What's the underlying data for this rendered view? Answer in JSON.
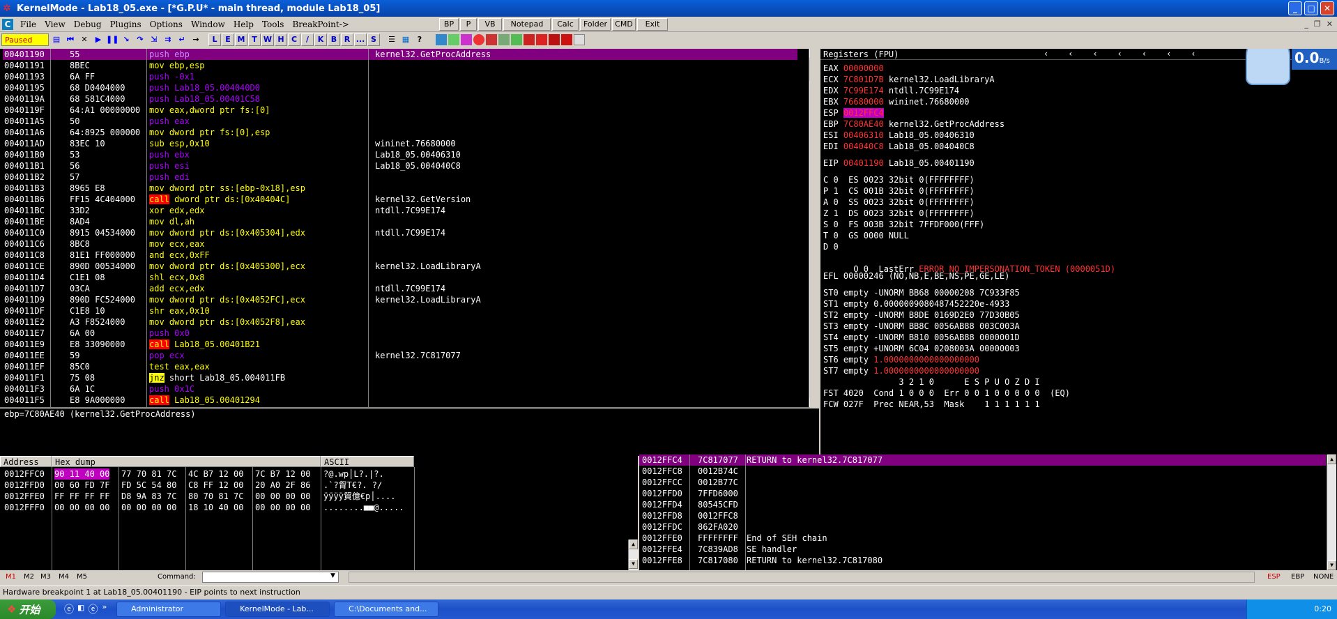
{
  "window": {
    "title": "KernelMode - Lab18_05.exe - [*G.P.U* - main thread, module Lab18_05]"
  },
  "menu": [
    "File",
    "View",
    "Debug",
    "Plugins",
    "Options",
    "Window",
    "Help",
    "Tools",
    "BreakPoint->"
  ],
  "quick_buttons": [
    "BP",
    "P",
    "VB",
    "Notepad",
    "Calc",
    "Folder",
    "CMD",
    "Exit"
  ],
  "toolbar": {
    "status": "Paused",
    "letters": [
      "L",
      "E",
      "M",
      "T",
      "W",
      "H",
      "C",
      "/",
      "K",
      "B",
      "R",
      "...",
      "S"
    ]
  },
  "disasm": [
    {
      "addr": "00401190",
      "hex": "55",
      "asm": "push ebp",
      "kind": "push",
      "cmt": "kernel32.GetProcAddress",
      "sel": true
    },
    {
      "addr": "00401191",
      "hex": "8BEC",
      "asm": "mov ebp,esp",
      "kind": "mov",
      "cmt": ""
    },
    {
      "addr": "00401193",
      "hex": "6A FF",
      "asm": "push -0x1",
      "kind": "push",
      "cmt": ""
    },
    {
      "addr": "00401195",
      "hex": "68 D0404000",
      "asm": "push Lab18_05.004040D0",
      "kind": "push",
      "cmt": ""
    },
    {
      "addr": "0040119A",
      "hex": "68 581C4000",
      "asm": "push Lab18_05.00401C58",
      "kind": "push",
      "cmt": ""
    },
    {
      "addr": "0040119F",
      "hex": "64:A1 00000000",
      "asm": "mov eax,dword ptr fs:[0]",
      "kind": "mov",
      "cmt": ""
    },
    {
      "addr": "004011A5",
      "hex": "50",
      "asm": "push eax",
      "kind": "push",
      "cmt": ""
    },
    {
      "addr": "004011A6",
      "hex": "64:8925 000000",
      "asm": "mov dword ptr fs:[0],esp",
      "kind": "mov",
      "cmt": ""
    },
    {
      "addr": "004011AD",
      "hex": "83EC 10",
      "asm": "sub esp,0x10",
      "kind": "mov",
      "cmt": "wininet.76680000"
    },
    {
      "addr": "004011B0",
      "hex": "53",
      "asm": "push ebx",
      "kind": "push",
      "cmt": "Lab18_05.00406310"
    },
    {
      "addr": "004011B1",
      "hex": "56",
      "asm": "push esi",
      "kind": "push",
      "cmt": "Lab18_05.004040C8"
    },
    {
      "addr": "004011B2",
      "hex": "57",
      "asm": "push edi",
      "kind": "push",
      "cmt": ""
    },
    {
      "addr": "004011B3",
      "hex": "8965 E8",
      "asm": "mov dword ptr ss:[ebp-0x18],esp",
      "kind": "mov",
      "cmt": ""
    },
    {
      "addr": "004011B6",
      "hex": "FF15 4C404000",
      "asm": "call dword ptr ds:[0x40404C]",
      "kind": "call",
      "cmt": "kernel32.GetVersion"
    },
    {
      "addr": "004011BC",
      "hex": "33D2",
      "asm": "xor edx,edx",
      "kind": "mov",
      "cmt": "ntdll.7C99E174"
    },
    {
      "addr": "004011BE",
      "hex": "8AD4",
      "asm": "mov dl,ah",
      "kind": "mov",
      "cmt": ""
    },
    {
      "addr": "004011C0",
      "hex": "8915 04534000",
      "asm": "mov dword ptr ds:[0x405304],edx",
      "kind": "mov",
      "cmt": "ntdll.7C99E174"
    },
    {
      "addr": "004011C6",
      "hex": "8BC8",
      "asm": "mov ecx,eax",
      "kind": "mov",
      "cmt": ""
    },
    {
      "addr": "004011C8",
      "hex": "81E1 FF000000",
      "asm": "and ecx,0xFF",
      "kind": "mov",
      "cmt": ""
    },
    {
      "addr": "004011CE",
      "hex": "890D 00534000",
      "asm": "mov dword ptr ds:[0x405300],ecx",
      "kind": "mov",
      "cmt": "kernel32.LoadLibraryA"
    },
    {
      "addr": "004011D4",
      "hex": "C1E1 08",
      "asm": "shl ecx,0x8",
      "kind": "mov",
      "cmt": ""
    },
    {
      "addr": "004011D7",
      "hex": "03CA",
      "asm": "add ecx,edx",
      "kind": "mov",
      "cmt": "ntdll.7C99E174"
    },
    {
      "addr": "004011D9",
      "hex": "890D FC524000",
      "asm": "mov dword ptr ds:[0x4052FC],ecx",
      "kind": "mov",
      "cmt": "kernel32.LoadLibraryA"
    },
    {
      "addr": "004011DF",
      "hex": "C1E8 10",
      "asm": "shr eax,0x10",
      "kind": "mov",
      "cmt": ""
    },
    {
      "addr": "004011E2",
      "hex": "A3 F8524000",
      "asm": "mov dword ptr ds:[0x4052F8],eax",
      "kind": "mov",
      "cmt": ""
    },
    {
      "addr": "004011E7",
      "hex": "6A 00",
      "asm": "push 0x0",
      "kind": "push",
      "cmt": ""
    },
    {
      "addr": "004011E9",
      "hex": "E8 33090000",
      "asm": "call Lab18_05.00401B21",
      "kind": "call",
      "cmt": ""
    },
    {
      "addr": "004011EE",
      "hex": "59",
      "asm": "pop ecx",
      "kind": "push",
      "cmt": "kernel32.7C817077"
    },
    {
      "addr": "004011EF",
      "hex": "85C0",
      "asm": "test eax,eax",
      "kind": "mov",
      "cmt": ""
    },
    {
      "addr": "004011F1",
      "hex": "75 08",
      "asm": "jnz short Lab18_05.004011FB",
      "kind": "jnz",
      "cmt": ""
    },
    {
      "addr": "004011F3",
      "hex": "6A 1C",
      "asm": "push 0x1C",
      "kind": "push",
      "cmt": ""
    },
    {
      "addr": "004011F5",
      "hex": "E8 9A000000",
      "asm": "call Lab18_05.00401294",
      "kind": "call",
      "cmt": ""
    }
  ],
  "info_line": "ebp=7C80AE40 (kernel32.GetProcAddress)",
  "registers": {
    "header": "Registers (FPU)",
    "gp": [
      {
        "n": "EAX",
        "v": "00000000",
        "c": ""
      },
      {
        "n": "ECX",
        "v": "7C801D7B",
        "c": "kernel32.LoadLibraryA"
      },
      {
        "n": "EDX",
        "v": "7C99E174",
        "c": "ntdll.7C99E174"
      },
      {
        "n": "EBX",
        "v": "76680000",
        "c": "wininet.76680000"
      },
      {
        "n": "ESP",
        "v": "0012FFC4",
        "c": ""
      },
      {
        "n": "EBP",
        "v": "7C80AE40",
        "c": "kernel32.GetProcAddress"
      },
      {
        "n": "ESI",
        "v": "00406310",
        "c": "Lab18_05.00406310"
      },
      {
        "n": "EDI",
        "v": "004040C8",
        "c": "Lab18_05.004040C8"
      }
    ],
    "eip": {
      "n": "EIP",
      "v": "00401190",
      "c": "Lab18_05.00401190"
    },
    "flags": [
      "C 0  ES 0023 32bit 0(FFFFFFFF)",
      "P 1  CS 001B 32bit 0(FFFFFFFF)",
      "A 0  SS 0023 32bit 0(FFFFFFFF)",
      "Z 1  DS 0023 32bit 0(FFFFFFFF)",
      "S 0  FS 003B 32bit 7FFDF000(FFF)",
      "T 0  GS 0000 NULL",
      "D 0"
    ],
    "lasterr": {
      "prefix": "O 0  LastErr ",
      "value": "ERROR_NO_IMPERSONATION_TOKEN (0000051D)"
    },
    "efl": "EFL 00000246 (NO,NB,E,BE,NS,PE,GE,LE)",
    "fpu": [
      {
        "l": "ST0 empty -UNORM BB68 00000208 7C933F85",
        "red": false
      },
      {
        "l": "ST1 empty 0.0000009080487452220e-4933",
        "red": false
      },
      {
        "l": "ST2 empty -UNORM B8DE 0169D2E0 77D30B05",
        "red": false
      },
      {
        "l": "ST3 empty -UNORM BB8C 0056AB88 003C003A",
        "red": false
      },
      {
        "l": "ST4 empty -UNORM B810 0056AB88 0000001D",
        "red": false
      },
      {
        "l": "ST5 empty +UNORM 6C04 0208003A 00000003",
        "red": false
      },
      {
        "l": "ST6 empty 1.0000000000000000000",
        "red": true
      },
      {
        "l": "ST7 empty 1.0000000000000000000",
        "red": true
      }
    ],
    "fstbits": "               3 2 1 0      E S P U O Z D I",
    "fst": "FST 4020  Cond 1 0 0 0  Err 0 0 1 0 0 0 0 0  (EQ)",
    "fcw": "FCW 027F  Prec NEAR,53  Mask    1 1 1 1 1 1"
  },
  "dump": {
    "headers": [
      "Address",
      "Hex dump",
      "ASCII"
    ],
    "rows": [
      {
        "addr": "0012FFC0",
        "hex": [
          "90 11 40 00",
          "77 70 81 7C",
          "4C B7 12 00",
          "7C B7 12 00"
        ],
        "ascii": "?@.wp│L?.|?."
      },
      {
        "addr": "0012FFD0",
        "hex": [
          "00 60 FD 7F",
          "FD 5C 54 80",
          "C8 FF 12 00",
          "20 A0 2F 86"
        ],
        "ascii": ".`?胷T€?. ?∕"
      },
      {
        "addr": "0012FFE0",
        "hex": [
          "FF FF FF FF",
          "D8 9A 83 7C",
          "80 70 81 7C",
          "00 00 00 00"
        ],
        "ascii": "ÿÿÿÿ貿億€p│...."
      },
      {
        "addr": "0012FFF0",
        "hex": [
          "00 00 00 00",
          "00 00 00 00",
          "18 10 40 00",
          "00 00 00 00"
        ],
        "ascii": "........■■@....."
      }
    ]
  },
  "stack": [
    {
      "addr": "0012FFC4",
      "val": "7C817077",
      "c": "RETURN to kernel32.7C817077",
      "sel": true
    },
    {
      "addr": "0012FFC8",
      "val": "0012B74C",
      "c": ""
    },
    {
      "addr": "0012FFCC",
      "val": "0012B77C",
      "c": ""
    },
    {
      "addr": "0012FFD0",
      "val": "7FFD6000",
      "c": ""
    },
    {
      "addr": "0012FFD4",
      "val": "80545CFD",
      "c": ""
    },
    {
      "addr": "0012FFD8",
      "val": "0012FFC8",
      "c": ""
    },
    {
      "addr": "0012FFDC",
      "val": "862FA020",
      "c": ""
    },
    {
      "addr": "0012FFE0",
      "val": "FFFFFFFF",
      "c": "End of SEH chain"
    },
    {
      "addr": "0012FFE4",
      "val": "7C839AD8",
      "c": "SE handler"
    },
    {
      "addr": "0012FFE8",
      "val": "7C817080",
      "c": "RETURN to kernel32.7C817080"
    }
  ],
  "command": {
    "tabs": [
      "M1",
      "M2",
      "M3",
      "M4",
      "M5"
    ],
    "label": "Command:",
    "right": [
      "ESP",
      "EBP",
      "NONE"
    ]
  },
  "status": "Hardware breakpoint 1 at Lab18_05.00401190 - EIP points to next instruction",
  "speed": "0.0",
  "speed_unit": "B/s",
  "taskbar": {
    "start": "开始",
    "tasks": [
      "Administrator",
      "KernelMode - Lab...",
      "C:\\Documents and..."
    ],
    "clock": "0:20"
  }
}
